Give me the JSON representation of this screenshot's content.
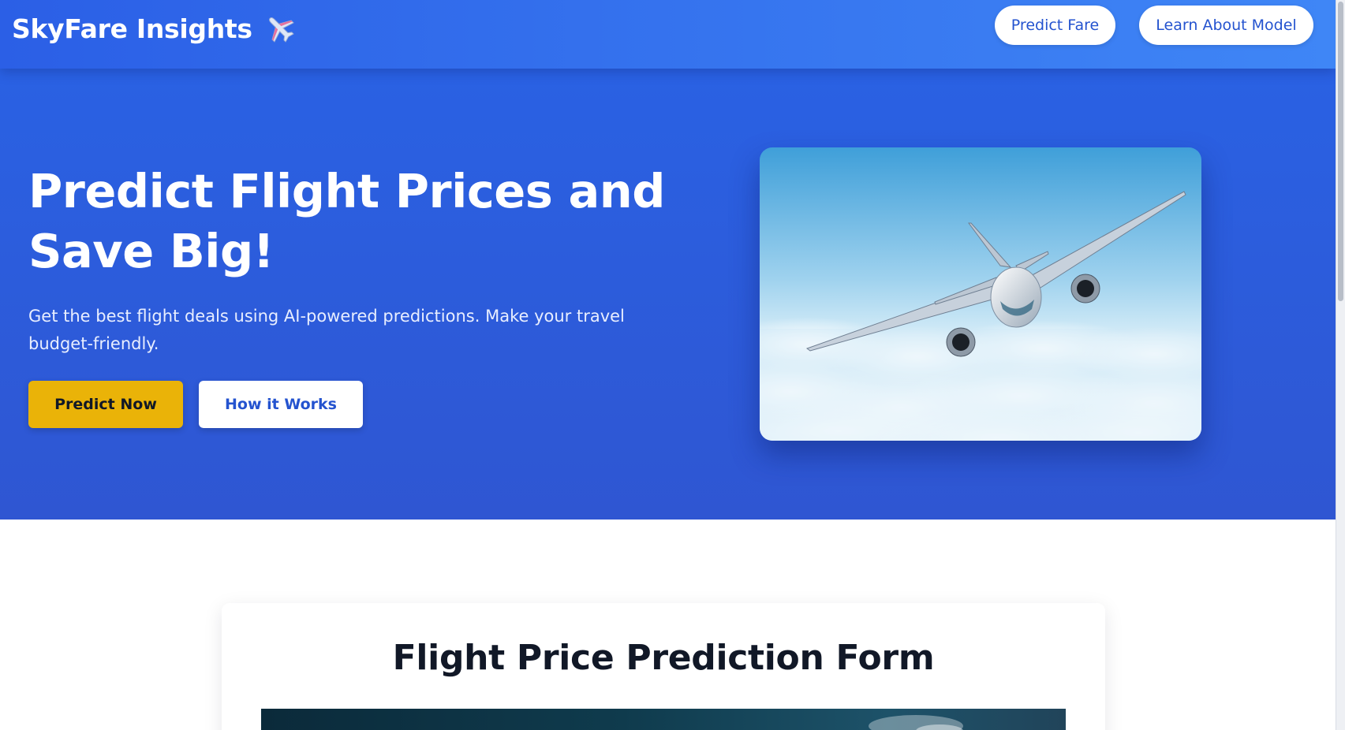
{
  "brand": {
    "title": "SkyFare Insights",
    "icon": "airplane-icon"
  },
  "nav": {
    "items": [
      {
        "label": "Predict Fare"
      },
      {
        "label": "Learn About Model"
      }
    ]
  },
  "hero": {
    "title": "Predict Flight Prices and Save Big!",
    "subtitle": "Get the best flight deals using AI-powered predictions. Make your travel budget-friendly.",
    "primary_cta": "Predict Now",
    "secondary_cta": "How it Works",
    "image": "airplane-in-sky-photo"
  },
  "form": {
    "title": "Flight Price Prediction Form"
  },
  "colors": {
    "hero_bg": "#2963e6",
    "nav_gradient_end": "#3f86f6",
    "primary_cta": "#eab308",
    "link_blue": "#2453cf",
    "heading_dark": "#111827"
  }
}
